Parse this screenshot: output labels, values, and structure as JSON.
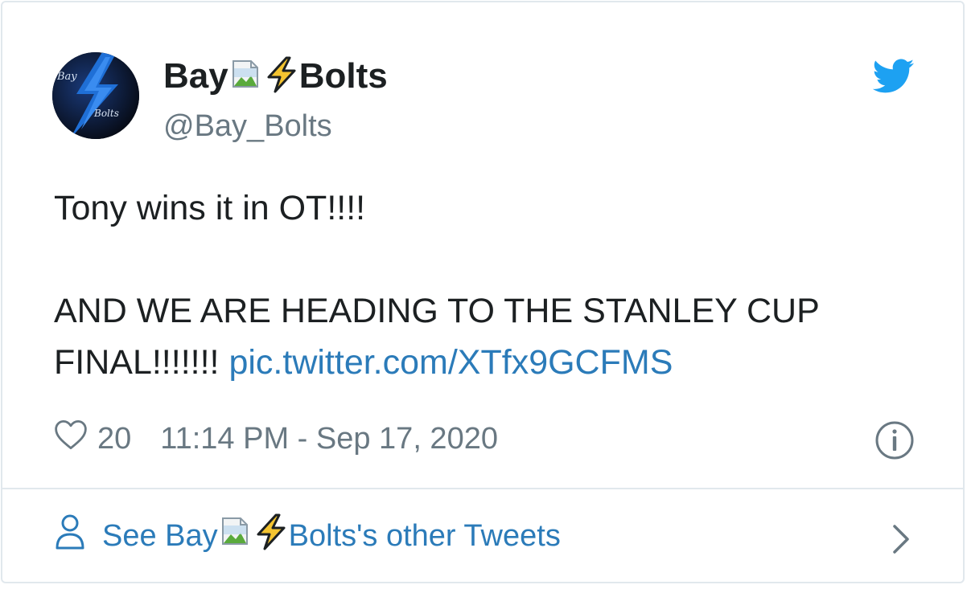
{
  "author": {
    "name_before": "Bay",
    "name_emoji": "⚡",
    "name_after": "Bolts",
    "handle": "@Bay_Bolts",
    "avatar_text_top": "Bay",
    "avatar_text_bottom": "Bolts"
  },
  "tweet": {
    "line1": "Tony wins it in OT!!!!",
    "line2": "AND WE ARE HEADING TO THE STANLEY CUP",
    "line3": "FINAL!!!!!!!",
    "link": "pic.twitter.com/XTfx9GCFMS"
  },
  "meta": {
    "likes": "20",
    "timestamp": "11:14 PM - Sep 17, 2020"
  },
  "footer": {
    "prefix": "See Bay",
    "emoji": "⚡",
    "suffix": "Bolts's other Tweets"
  },
  "icons": {
    "avatar": "bay-bolts-logo",
    "broken_image": "broken-image-icon",
    "bolt": "lightning-bolt-icon",
    "twitter": "twitter-bird-icon",
    "heart": "heart-icon",
    "info": "info-icon",
    "person": "person-icon",
    "chevron": "chevron-right-icon"
  },
  "colors": {
    "text": "#1c2022",
    "muted": "#697882",
    "link": "#2b7bb9",
    "twitter_blue": "#1da1f2",
    "border": "#e1e8ed",
    "bolt_yellow": "#f4c430"
  }
}
